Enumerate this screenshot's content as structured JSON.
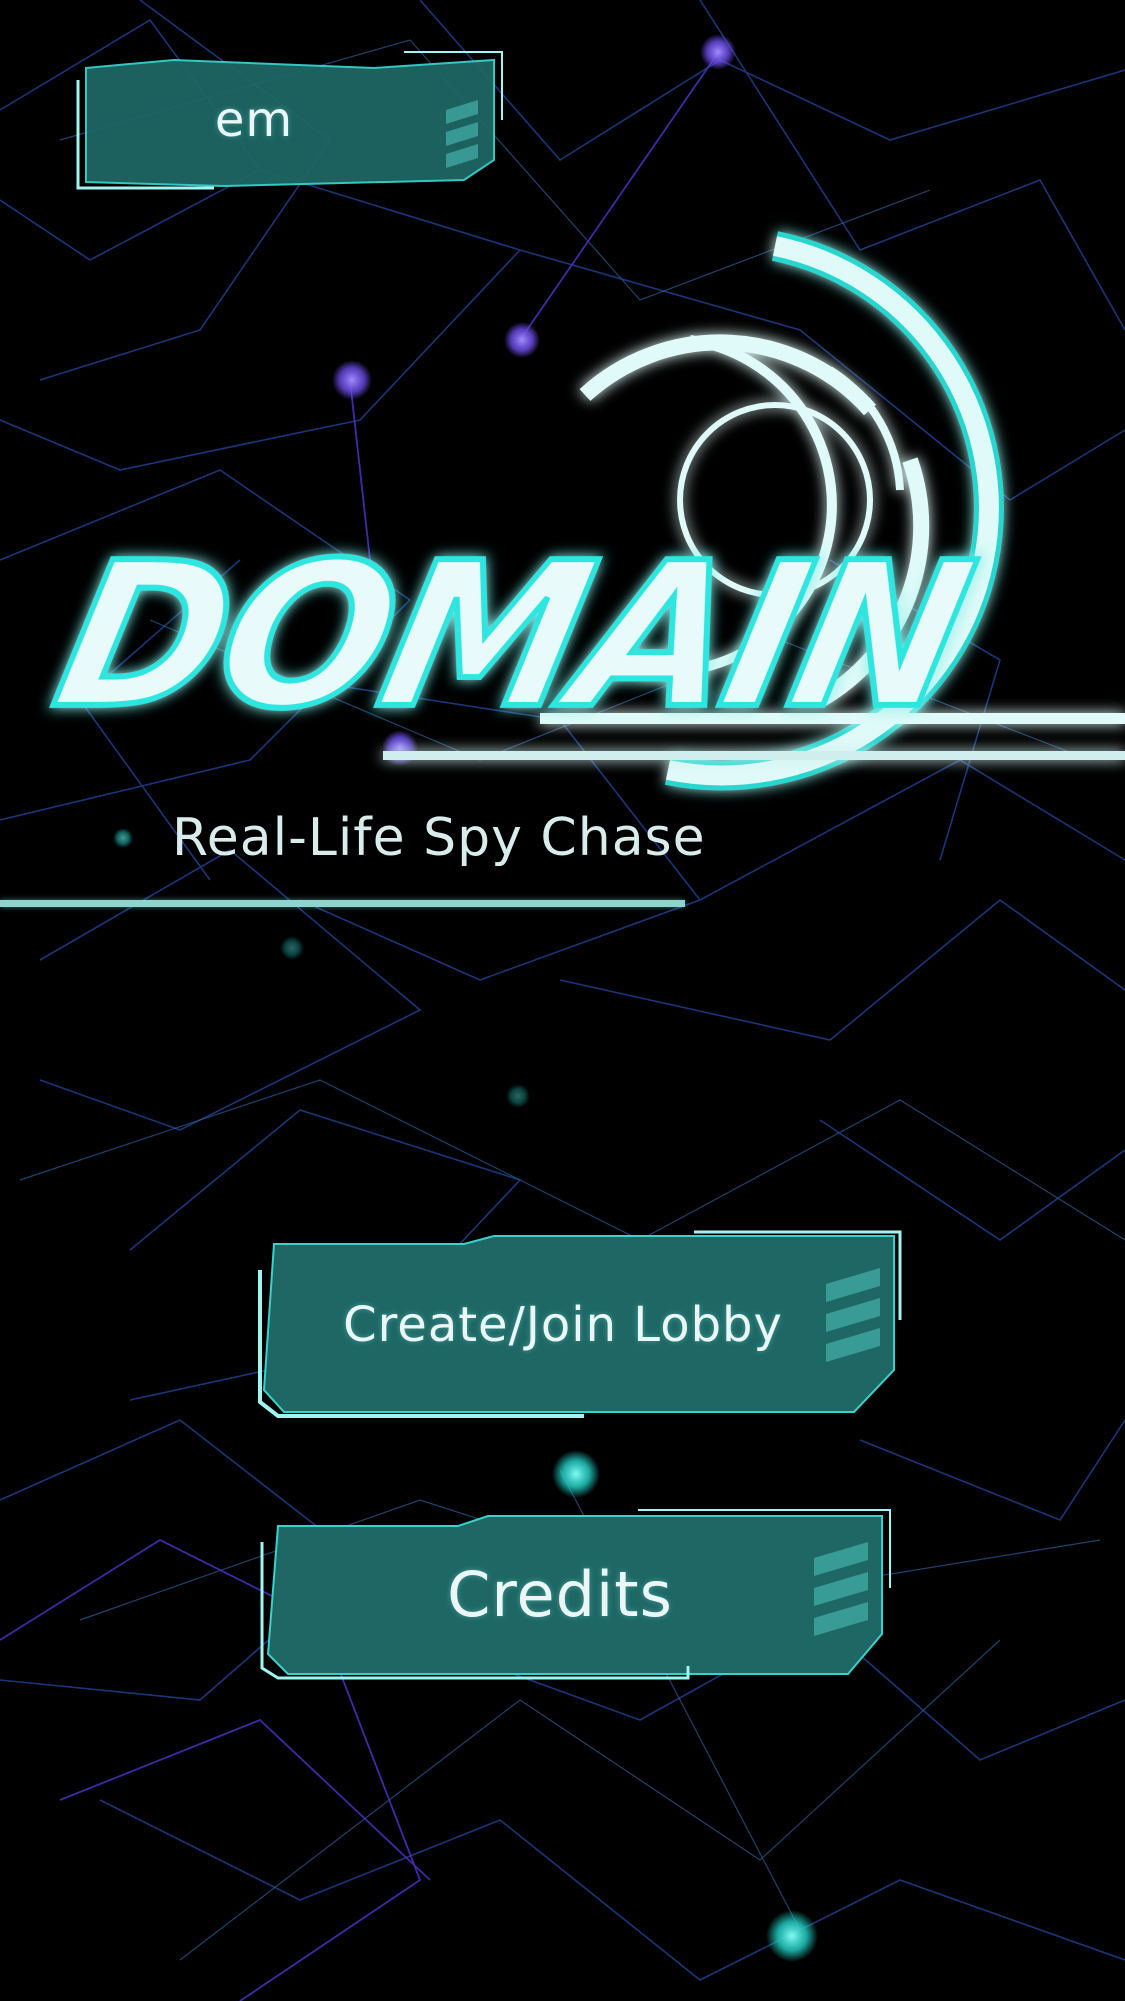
{
  "user": {
    "name": "em"
  },
  "logo": {
    "title": "DOMAIN"
  },
  "subtitle": "Real-Life Spy Chase",
  "buttons": {
    "lobby_label": "Create/Join Lobby",
    "credits_label": "Credits"
  },
  "colors": {
    "background": "#000000",
    "accent": "#2ee6e0",
    "button_fill": "#1e6764",
    "network_blue": "#1f3f8a",
    "network_purple": "#5a3ad0"
  }
}
